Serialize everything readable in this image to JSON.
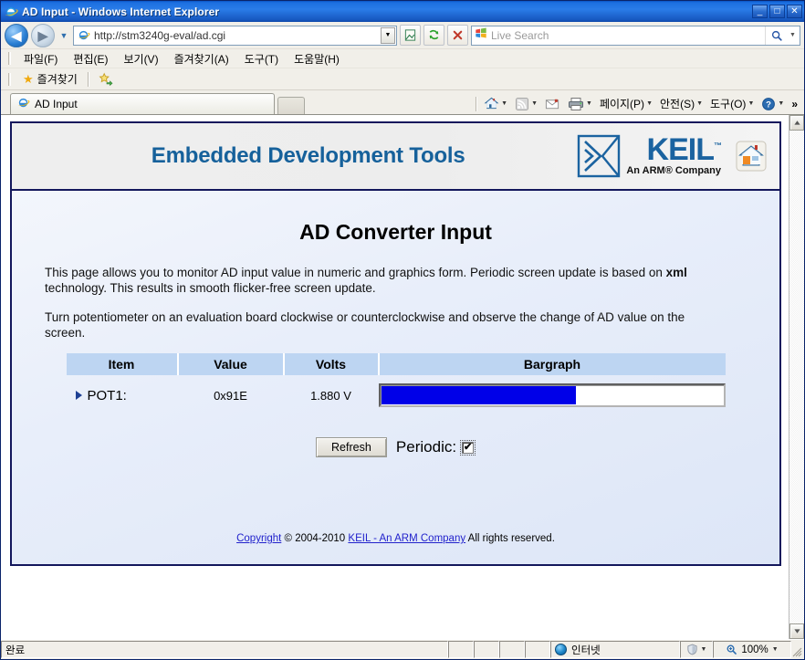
{
  "window": {
    "title": "AD Input - Windows Internet Explorer",
    "minimize_label": "_",
    "maximize_label": "□",
    "close_label": "✕"
  },
  "navigation": {
    "back_label": "◀",
    "forward_label": "▶",
    "history_caret": "▼",
    "url": "http://stm3240g-eval/ad.cgi",
    "url_dropdown_caret": "▼",
    "buttons": [
      {
        "name": "compatibility-view-button",
        "icon": "compatibility-icon"
      },
      {
        "name": "refresh-button",
        "icon": "refresh-icon"
      },
      {
        "name": "stop-button",
        "icon": "stop-icon"
      }
    ],
    "search_placeholder": "Live Search",
    "search_go_caret": "▼"
  },
  "menubar": {
    "items": [
      {
        "label": "파일(F)",
        "name": "menu-file"
      },
      {
        "label": "편집(E)",
        "name": "menu-edit"
      },
      {
        "label": "보기(V)",
        "name": "menu-view"
      },
      {
        "label": "즐겨찾기(A)",
        "name": "menu-favorites"
      },
      {
        "label": "도구(T)",
        "name": "menu-tools"
      },
      {
        "label": "도움말(H)",
        "name": "menu-help"
      }
    ]
  },
  "favoritesbar": {
    "favorites_label": "즐겨찾기",
    "star_icon": "★",
    "add_icon": "★"
  },
  "tabs": {
    "items": [
      {
        "label": "AD Input",
        "name": "tab-ad-input"
      }
    ],
    "new_tab_label": ""
  },
  "command_bar": {
    "home_caret": "▼",
    "feeds_caret": "▼",
    "print_caret": "▼",
    "items": [
      {
        "label": "페이지(P)",
        "name": "command-page"
      },
      {
        "label": "안전(S)",
        "name": "command-safety"
      },
      {
        "label": "도구(O)",
        "name": "command-tools"
      }
    ],
    "help_caret": "▼",
    "overflow_label": "»"
  },
  "page": {
    "header": {
      "site_title": "Embedded Development Tools",
      "logo_word": "KEIL",
      "logo_tm": "™",
      "logo_tagline": "An ARM® Company"
    },
    "title": "AD Converter Input",
    "paragraphs": [
      {
        "before": "This page allows you to monitor AD input value in numeric and graphics form. Periodic screen update is based on ",
        "bold": "xml",
        "after": " technology. This results in smooth flicker-free screen update."
      },
      {
        "before": "Turn potentiometer on an evaluation board clockwise or counterclockwise and observe the change of AD value on the screen.",
        "bold": "",
        "after": ""
      }
    ],
    "table": {
      "headers": [
        "Item",
        "Value",
        "Volts",
        "Bargraph"
      ],
      "rows": [
        {
          "item": "POT1:",
          "value": "0x91E",
          "volts": "1.880 V",
          "bar_percent": 57
        }
      ]
    },
    "controls": {
      "refresh_label": "Refresh",
      "periodic_label": "Periodic:",
      "periodic_checked": true,
      "check_glyph": "✔"
    },
    "footer": {
      "copyright_link": "Copyright",
      "copyright_symbol": "©",
      "years": "2004-2010",
      "company_link": "KEIL - An ARM Company",
      "rights": "All rights reserved."
    }
  },
  "scrollbar": {
    "up_label": "▲",
    "down_label": "▼"
  },
  "statusbar": {
    "status": "완료",
    "zone": "인터넷",
    "protected_caret": "▼",
    "zoom": "100%",
    "zoom_caret": "▼",
    "zoom_icon": "🔍"
  },
  "colors": {
    "title_bar": "#1c6fe0",
    "keil_blue": "#1b63a0",
    "heading_blue": "#16619b",
    "bar_fill": "#0000e8",
    "table_header": "#bdd5f2",
    "panel_border": "#13175c",
    "link": "#2222cc"
  }
}
